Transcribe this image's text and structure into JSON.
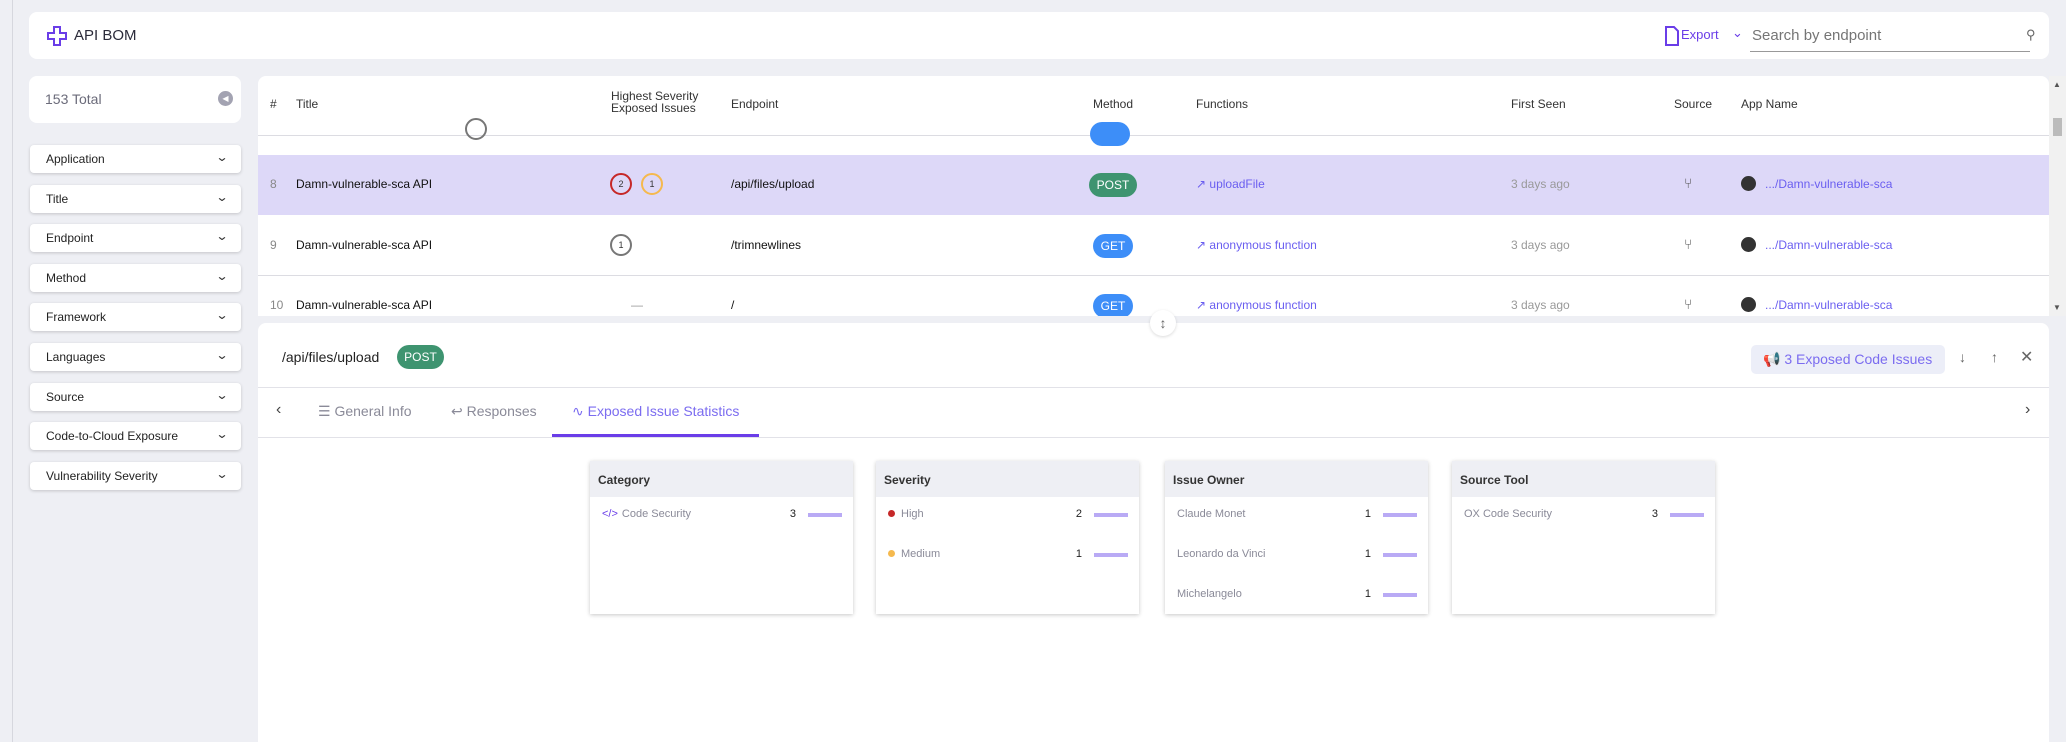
{
  "header": {
    "title": "API BOM",
    "export_label": "Export",
    "search_placeholder": "Search by endpoint"
  },
  "sidebar": {
    "total": "153 Total",
    "filters": [
      "Application",
      "Title",
      "Endpoint",
      "Method",
      "Framework",
      "Languages",
      "Source",
      "Code-to-Cloud Exposure",
      "Vulnerability Severity"
    ]
  },
  "table": {
    "columns": {
      "num": "#",
      "title": "Title",
      "sev1": "Highest Severity",
      "sev2": "Exposed Issues",
      "endpoint": "Endpoint",
      "method": "Method",
      "functions": "Functions",
      "first_seen": "First Seen",
      "source": "Source",
      "app_name": "App Name"
    },
    "rows": [
      {
        "num": "8",
        "title": "Damn-vulnerable-sca API",
        "high": "2",
        "medium": "1",
        "endpoint": "/api/files/upload",
        "method": "POST",
        "function": "uploadFile",
        "first_seen": "3 days ago",
        "app": ".../Damn-vulnerable-sca",
        "selected": true
      },
      {
        "num": "9",
        "title": "Damn-vulnerable-sca API",
        "other": "1",
        "endpoint": "/trimnewlines",
        "method": "GET",
        "function": "anonymous function",
        "first_seen": "3 days ago",
        "app": ".../Damn-vulnerable-sca"
      },
      {
        "num": "10",
        "title": "Damn-vulnerable-sca API",
        "none": "—",
        "endpoint": "/",
        "method": "GET",
        "function": "anonymous function",
        "first_seen": "3 days ago",
        "app": ".../Damn-vulnerable-sca"
      }
    ]
  },
  "detail": {
    "endpoint": "/api/files/upload",
    "method": "POST",
    "issues_button": "3 Exposed Code Issues",
    "tabs": [
      "General Info",
      "Responses",
      "Exposed Issue Statistics"
    ],
    "active_tab": "Exposed Issue Statistics",
    "cards": [
      {
        "title": "Category",
        "items": [
          {
            "label": "Code Security",
            "count": "3"
          }
        ]
      },
      {
        "title": "Severity",
        "items": [
          {
            "label": "High",
            "count": "2",
            "color": "#c62828"
          },
          {
            "label": "Medium",
            "count": "1",
            "color": "#f5b94e"
          }
        ]
      },
      {
        "title": "Issue Owner",
        "items": [
          {
            "label": "Claude Monet",
            "count": "1"
          },
          {
            "label": "Leonardo da Vinci",
            "count": "1"
          },
          {
            "label": "Michelangelo",
            "count": "1"
          }
        ]
      },
      {
        "title": "Source Tool",
        "items": [
          {
            "label": "OX Code Security",
            "count": "3"
          }
        ]
      }
    ]
  },
  "colors": {
    "accent": "#6a3de8",
    "post": "#3e9470",
    "get": "#3d8ef8",
    "selected_row": "#ddd8f8",
    "high": "#c62828",
    "medium": "#f5b94e"
  }
}
